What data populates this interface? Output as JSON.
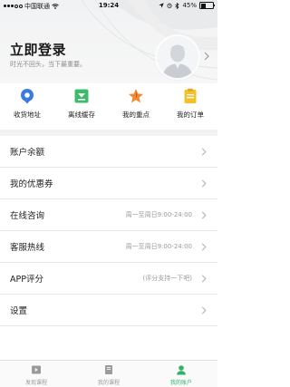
{
  "status_bar": {
    "carrier": "中国联通",
    "time": "19:24",
    "battery": "45%",
    "battery_level": 0.45
  },
  "header": {
    "title": "立即登录",
    "subtitle": "时光不回头，当下最重要。"
  },
  "quick_actions": [
    {
      "label": "收货地址",
      "icon": "location-pin-icon",
      "color": "#3b7be0"
    },
    {
      "label": "离线缓存",
      "icon": "download-icon",
      "color": "#3dbb6b"
    },
    {
      "label": "我的重点",
      "icon": "star-icon",
      "color": "#f08a2e"
    },
    {
      "label": "我的订单",
      "icon": "order-icon",
      "color": "#f3c12e"
    }
  ],
  "menu": [
    {
      "title": "账户余额",
      "note": ""
    },
    {
      "title": "我的优惠券",
      "note": ""
    },
    {
      "title": "在线咨询",
      "note": "周一至周日9:00-24:00"
    },
    {
      "title": "客服热线",
      "note": "周一至周日9:00-24:00"
    },
    {
      "title": "APP评分",
      "note": "(评分支持一下吧)"
    },
    {
      "title": "设置",
      "note": ""
    }
  ],
  "tabbar": {
    "tabs": [
      {
        "label": "发现课程",
        "active": false
      },
      {
        "label": "我的课程",
        "active": false
      },
      {
        "label": "我的账户",
        "active": true
      }
    ],
    "active_color": "#2fb36a"
  }
}
